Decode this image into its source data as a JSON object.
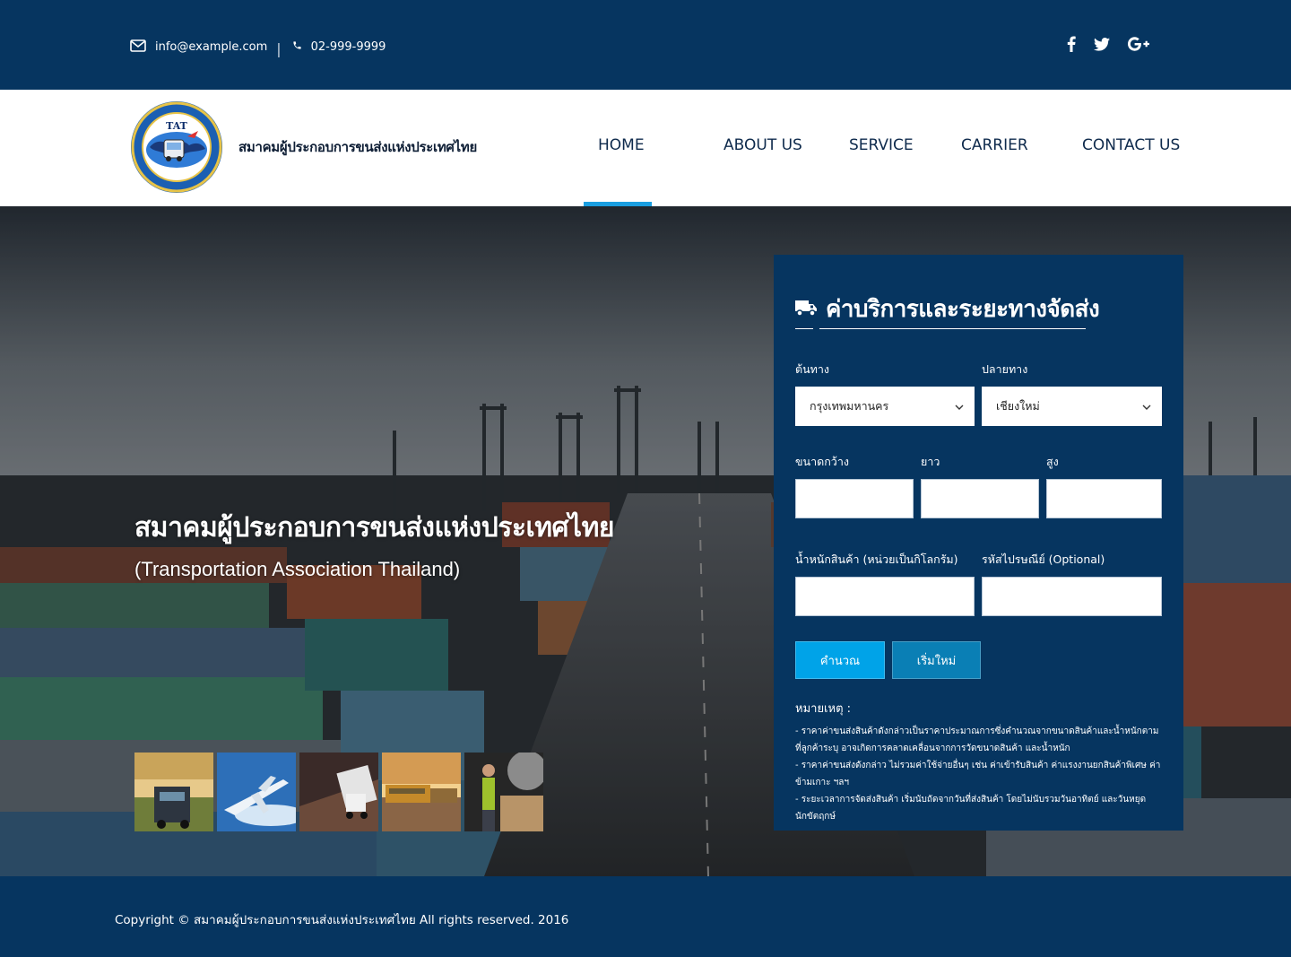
{
  "topbar": {
    "email": "info@example.com",
    "separator": "|",
    "phone": "02-999-9999",
    "social": [
      "facebook-icon",
      "twitter-icon",
      "google-plus-icon"
    ]
  },
  "header": {
    "logo_text": "TAT",
    "brand_name": "สมาคมผู้ประกอบการขนส่งแห่งประเทศไทย",
    "nav": [
      {
        "label": "HOME",
        "active": true
      },
      {
        "label": "ABOUT US",
        "active": false
      },
      {
        "label": "SERVICE",
        "active": false
      },
      {
        "label": "CARRIER",
        "active": false
      },
      {
        "label": "CONTACT US",
        "active": false
      }
    ]
  },
  "hero": {
    "title": "สมาคมผู้ประกอบการขนส่งแห่งประเทศไทย",
    "subtitle": "(Transportation Association Thailand)",
    "thumbnails": [
      "truck-thumbnail",
      "airplane-thumbnail",
      "trucks-road-thumbnail",
      "train-thumbnail",
      "warehouse-worker-thumbnail"
    ]
  },
  "form": {
    "title": "ค่าบริการและระยะทางจัดส่ง",
    "origin_label": "ต้นทาง",
    "origin_value": "กรุงเทพมหานคร",
    "destination_label": "ปลายทาง",
    "destination_value": "เชียงใหม่",
    "width_label": "ขนาดกว้าง",
    "length_label": "ยาว",
    "height_label": "สูง",
    "weight_label": "น้ำหนักสินค้า (หน่วยเป็นกิโลกรัม)",
    "postcode_label": "รหัสไปรษณีย์ (Optional)",
    "calculate_label": "คำนวณ",
    "reset_label": "เริ่มใหม่",
    "note_title": "หมายเหตุ :",
    "notes": [
      "- ราคาค่าขนส่งสินค้าดังกล่าวเป็นราคาประมาณการซึ่งคำนวณจากขนาดสินค้าและน้ำหนักตามที่ลูกค้าระบุ อาจเกิดการคลาดเคลื่อนจากการวัดขนาดสินค้า และน้ำหนัก",
      "- ราคาค่าขนส่งดังกล่าว ไม่รวมค่าใช้จ่ายอื่นๆ เช่น ค่าเข้ารับสินค้า ค่าแรงงานยกสินค้าพิเศษ ค่า ข้ามเกาะ ฯลฯ",
      "- ระยะเวลาการจัดส่งสินค้า เริ่มนับถัดจากวันที่ส่งสินค้า โดยไม่นับรวมวันอาทิตย์ และวันหยุดนักขัตฤกษ์"
    ]
  },
  "footer": {
    "copyright": "Copyright © สมาคมผู้ประกอบการขนส่งแห่งประเทศไทย All rights reserved. 2016"
  },
  "colors": {
    "navy": "#063560",
    "accent": "#1a9ee0",
    "calc_button": "#00a3e8",
    "reset_button": "#0a7fb5"
  }
}
